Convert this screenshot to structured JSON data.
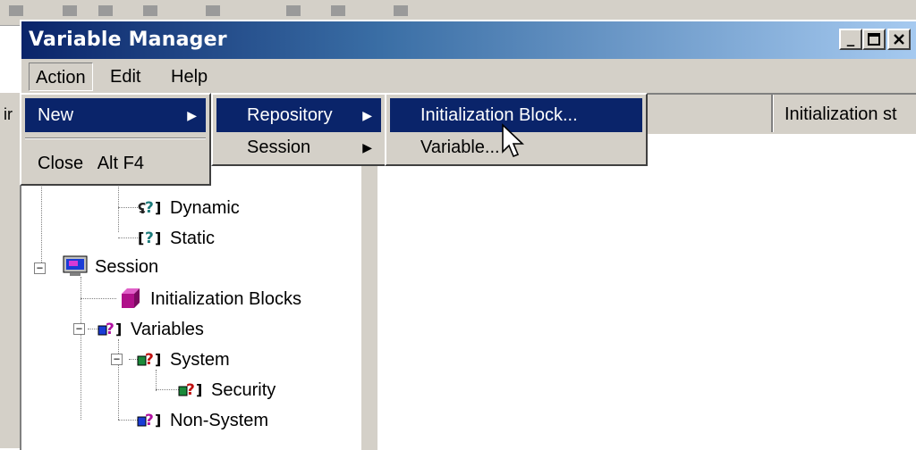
{
  "window": {
    "title": "Variable Manager"
  },
  "menubar": {
    "items": [
      "Action",
      "Edit",
      "Help"
    ]
  },
  "action_menu": {
    "new_label": "New",
    "close_label": "Close",
    "close_shortcut": "Alt F4"
  },
  "new_submenu": {
    "items": [
      {
        "label": "Repository",
        "has_submenu": true
      },
      {
        "label": "Session",
        "has_submenu": true
      }
    ]
  },
  "repository_submenu": {
    "items": [
      "Initialization Block...",
      "Variable..."
    ]
  },
  "list_pane": {
    "columns": [
      "",
      "Initialization st"
    ]
  },
  "tree": {
    "hidden_partial_label": "s",
    "nodes": [
      {
        "label": "Dynamic",
        "icon": "dynamic-variable-icon"
      },
      {
        "label": "Static",
        "icon": "static-variable-icon"
      },
      {
        "label": "Session",
        "icon": "session-monitor-icon"
      },
      {
        "label": "Initialization Blocks",
        "icon": "init-block-cube-icon"
      },
      {
        "label": "Variables",
        "icon": "variables-icon"
      },
      {
        "label": "System",
        "icon": "system-variable-icon"
      },
      {
        "label": "Security",
        "icon": "security-variable-icon"
      },
      {
        "label": "Non-System",
        "icon": "nonsystem-variable-icon"
      }
    ]
  },
  "colors": {
    "title_gradient_start": "#0a246a",
    "title_gradient_end": "#a6caf0",
    "menu_highlight": "#0a246a",
    "face": "#d4d0c8"
  }
}
